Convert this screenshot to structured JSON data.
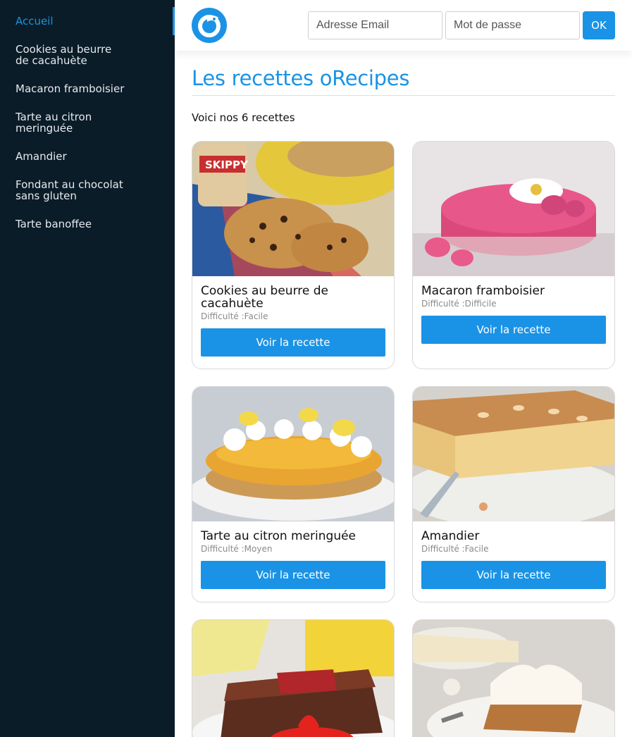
{
  "sidebar": {
    "items": [
      {
        "label": "Accueil"
      },
      {
        "label": "Cookies au beurre de cacahuète"
      },
      {
        "label": "Macaron framboisier"
      },
      {
        "label": "Tarte au citron meringuée"
      },
      {
        "label": "Amandier"
      },
      {
        "label": "Fondant au chocolat sans gluten"
      },
      {
        "label": "Tarte banoffee"
      }
    ],
    "active_index": 0
  },
  "header": {
    "logo_icon": "orecipes-logo-icon",
    "email_placeholder": "Adresse Email",
    "password_placeholder": "Mot de passe",
    "ok_label": "OK"
  },
  "main": {
    "title": "Les recettes oRecipes",
    "subtitle": "Voici nos 6 recettes",
    "recipes": [
      {
        "title": "Cookies au beurre de cacahuète",
        "difficulty": "Difficulté :Facile",
        "button": "Voir la recette"
      },
      {
        "title": "Macaron framboisier",
        "difficulty": "Difficulté :Difficile",
        "button": "Voir la recette"
      },
      {
        "title": "Tarte au citron meringuée",
        "difficulty": "Difficulté :Moyen",
        "button": "Voir la recette"
      },
      {
        "title": "Amandier",
        "difficulty": "Difficulté :Facile",
        "button": "Voir la recette"
      },
      {
        "title": "Fondant au chocolat sans gluten",
        "difficulty": "",
        "button": ""
      },
      {
        "title": "Tarte banoffee",
        "difficulty": "",
        "button": ""
      }
    ]
  },
  "colors": {
    "accent": "#1a93e6",
    "sidebar_bg": "#0a1c28"
  }
}
